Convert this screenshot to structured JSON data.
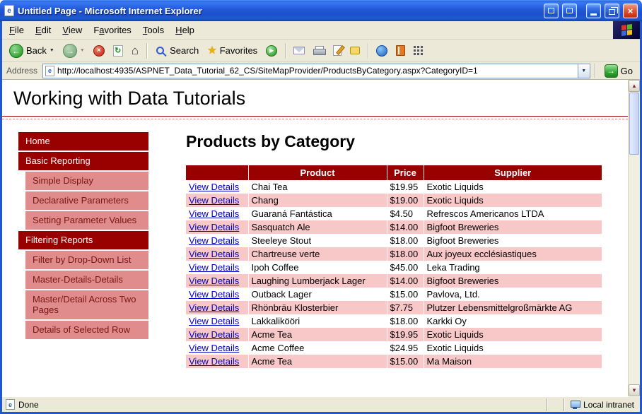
{
  "colors": {
    "maroon": "#990000",
    "sidebar_pink": "#e08c8c",
    "row_pink": "#f8c8c8",
    "link_blue": "#0000cc",
    "chrome": "#ece9d8",
    "frame_blue": "#2058d0"
  },
  "icons": {
    "ie_page": "e",
    "back_arrow": "←",
    "forward_arrow": "→",
    "dropdown_arrow": "▼",
    "stop_x": "×",
    "refresh_arrows": "↻",
    "home_house": "⌂",
    "favorites_star": "★",
    "media_play": "▶",
    "go_arrow": "→",
    "scroll_up": "▲",
    "scroll_down": "▼",
    "close_x": "×"
  },
  "window": {
    "title": "Untitled Page - Microsoft Internet Explorer"
  },
  "menu": {
    "items": [
      {
        "label": "File",
        "accel": 0
      },
      {
        "label": "Edit",
        "accel": 0
      },
      {
        "label": "View",
        "accel": 0
      },
      {
        "label": "Favorites",
        "accel": 1
      },
      {
        "label": "Tools",
        "accel": 0
      },
      {
        "label": "Help",
        "accel": 0
      }
    ]
  },
  "toolbar": {
    "back_label": "Back",
    "search_label": "Search",
    "favorites_label": "Favorites"
  },
  "address": {
    "label": "Address",
    "url": "http://localhost:4935/ASPNET_Data_Tutorial_62_CS/SiteMapProvider/ProductsByCategory.aspx?CategoryID=1",
    "go_label": "Go"
  },
  "page": {
    "header": "Working with Data Tutorials",
    "heading": "Products by Category",
    "sidebar": [
      {
        "label": "Home",
        "level": 0
      },
      {
        "label": "Basic Reporting",
        "level": 0
      },
      {
        "label": "Simple Display",
        "level": 1
      },
      {
        "label": "Declarative Parameters",
        "level": 1
      },
      {
        "label": "Setting Parameter Values",
        "level": 1
      },
      {
        "label": "Filtering Reports",
        "level": 0
      },
      {
        "label": "Filter by Drop-Down List",
        "level": 1
      },
      {
        "label": "Master-Details-Details",
        "level": 1
      },
      {
        "label": "Master/Detail Across Two Pages",
        "level": 1
      },
      {
        "label": "Details of Selected Row",
        "level": 1
      }
    ],
    "table": {
      "link_label": "View Details",
      "columns": [
        "",
        "Product",
        "Price",
        "Supplier"
      ],
      "rows": [
        [
          "Chai Tea",
          "$19.95",
          "Exotic Liquids"
        ],
        [
          "Chang",
          "$19.00",
          "Exotic Liquids"
        ],
        [
          "Guaraná Fantástica",
          "$4.50",
          "Refrescos Americanos LTDA"
        ],
        [
          "Sasquatch Ale",
          "$14.00",
          "Bigfoot Breweries"
        ],
        [
          "Steeleye Stout",
          "$18.00",
          "Bigfoot Breweries"
        ],
        [
          "Chartreuse verte",
          "$18.00",
          "Aux joyeux ecclésiastiques"
        ],
        [
          "Ipoh Coffee",
          "$45.00",
          "Leka Trading"
        ],
        [
          "Laughing Lumberjack Lager",
          "$14.00",
          "Bigfoot Breweries"
        ],
        [
          "Outback Lager",
          "$15.00",
          "Pavlova, Ltd."
        ],
        [
          "Rhönbräu Klosterbier",
          "$7.75",
          "Plutzer Lebensmittelgroßmärkte AG"
        ],
        [
          "Lakkalikööri",
          "$18.00",
          "Karkki Oy"
        ],
        [
          "Acme Tea",
          "$19.95",
          "Exotic Liquids"
        ],
        [
          "Acme Coffee",
          "$24.95",
          "Exotic Liquids"
        ],
        [
          "Acme Tea",
          "$15.00",
          "Ma Maison"
        ]
      ]
    }
  },
  "status": {
    "done": "Done",
    "zone": "Local intranet"
  }
}
